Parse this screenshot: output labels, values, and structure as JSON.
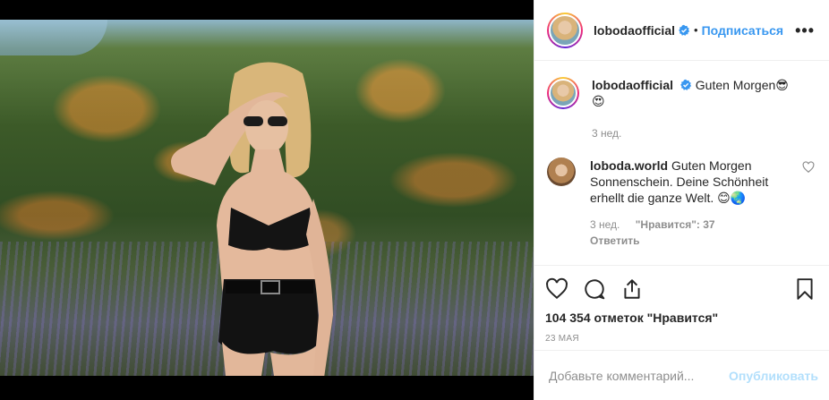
{
  "post": {
    "username": "lobodaofficial",
    "follow_label": "Подписаться",
    "separator": "•",
    "more_label": "•••"
  },
  "caption": {
    "username": "lobodaofficial",
    "text": "Guten Morgen😎",
    "text_line2": "😍",
    "time": "3 нед."
  },
  "comment": {
    "username": "loboda.world",
    "text": "Guten Morgen Sonnenschein. Deine Schönheit erhellt die ganze Welt. 😊🌏",
    "time": "3 нед.",
    "likes_label": "\"Нравится\": 37",
    "reply_label": "Ответить"
  },
  "likes_text": "104 354 отметок \"Нравится\"",
  "date_text": "23 мая",
  "add_comment": {
    "placeholder": "Добавьте комментарий...",
    "publish_label": "Опубликовать"
  },
  "icons": [
    "heart-icon",
    "comment-icon",
    "share-icon",
    "bookmark-icon",
    "verified-icon",
    "more-icon"
  ],
  "colors": {
    "accent": "#3897f0",
    "publish_disabled": "#b2dffc",
    "muted": "#8e8e8e"
  }
}
